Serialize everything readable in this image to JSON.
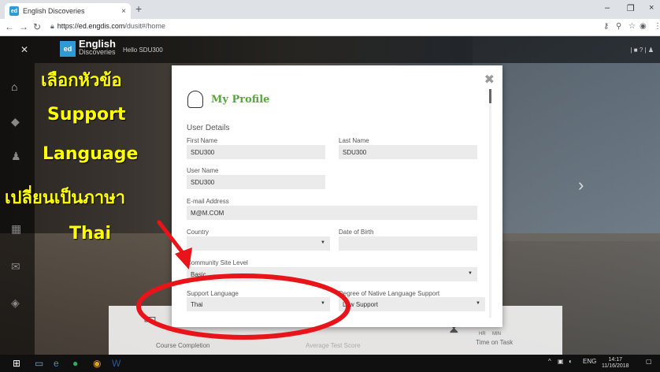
{
  "browser": {
    "tab_title": "English Discoveries",
    "tab_favicon": "ed",
    "tab_close": "×",
    "new_tab": "+",
    "url_host": "https://ed.engdis.com",
    "url_path": "/dusit#/home",
    "win_minimize": "–",
    "win_restore": "❐",
    "win_close": "×"
  },
  "app": {
    "logo_mark": "ed",
    "logo_title": "English",
    "logo_subtitle": "Discoveries",
    "greeting": "Hello SDU300",
    "top_right": "| ■   ? | ♟"
  },
  "annotation": {
    "line1": "เลือกหัวข้อ",
    "line2": "Support",
    "line3": "Language",
    "line4": "เปลี่ยนเป็นภาษา",
    "line5": "Thai",
    "color": "#ffff00",
    "ring_color": "#e8141a"
  },
  "modal": {
    "title": "My Profile",
    "close": "✖",
    "section": "User Details",
    "first_name_label": "First Name",
    "first_name": "SDU300",
    "last_name_label": "Last Name",
    "last_name": "SDU300",
    "user_name_label": "User Name",
    "user_name": "SDU300",
    "email_label": "E-mail Address",
    "email": "M@M.COM",
    "country_label": "Country",
    "country": "",
    "dob_label": "Date of Birth",
    "dob": "",
    "community_label": "Community Site Level",
    "community": "Basic",
    "support_lang_label": "Support Language",
    "support_lang": "Thai",
    "degree_label": "Degree of Native Language Support",
    "degree": "Low Support"
  },
  "bottom": {
    "course_completion": "Course Completion",
    "average_test_score": "Average Test Score",
    "time_on_task": "Time on Task",
    "hr_label": "HR",
    "min_label": "MIN"
  },
  "taskbar": {
    "lang": "ENG",
    "time": "14:17",
    "date": "11/16/2018"
  }
}
